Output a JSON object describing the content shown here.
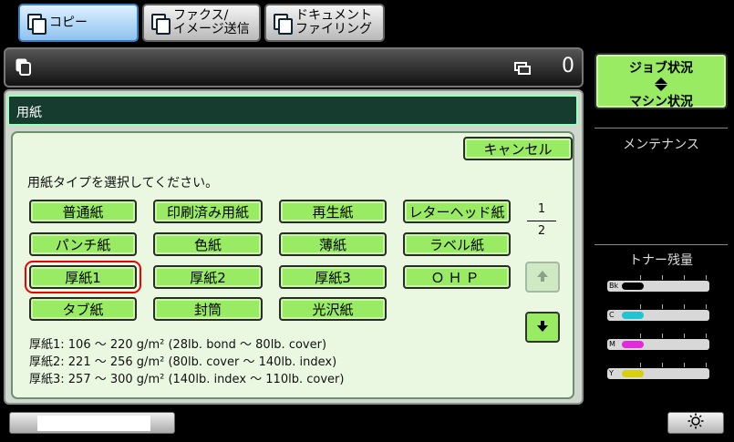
{
  "tabs": [
    {
      "label_1": "コピー",
      "label_2": ""
    },
    {
      "label_1": "ファクス/",
      "label_2": "イメージ送信"
    },
    {
      "label_1": "ドキュメント",
      "label_2": "ファイリング"
    }
  ],
  "status": {
    "job_count": "0"
  },
  "panel": {
    "title": "用紙",
    "cancel_label": "キャンセル",
    "prompt": "用紙タイプを選択してください。",
    "paper_buttons": [
      "普通紙",
      "印刷済み用紙",
      "再生紙",
      "レターヘッド紙",
      "パンチ紙",
      "色紙",
      "薄紙",
      "ラベル紙",
      "厚紙1",
      "厚紙2",
      "厚紙3",
      "ＯＨＰ",
      "タブ紙",
      "封筒",
      "光沢紙"
    ],
    "selected": "厚紙1",
    "page_current": "1",
    "page_total": "2",
    "specs": [
      "厚紙1: 106 ～ 220 g/m² (28lb. bond ～ 80lb. cover)",
      "厚紙2: 221 ～ 256 g/m² (80lb. cover ～ 140lb. index)",
      "厚紙3: 257 ～ 300 g/m² (140lb. index ～ 110lb. cover)"
    ]
  },
  "right": {
    "job_status_label": "ジョブ状況",
    "machine_status_label": "マシン状況",
    "maintenance_label": "メンテナンス",
    "toner_label": "トナー残量",
    "toner": [
      {
        "name": "Bk",
        "level": 0.4,
        "color": "#000000"
      },
      {
        "name": "C",
        "level": 0.4,
        "color": "#23c3d3"
      },
      {
        "name": "M",
        "level": 0.4,
        "color": "#e22ad8"
      },
      {
        "name": "Y",
        "level": 0.4,
        "color": "#d6cf12"
      }
    ]
  },
  "icons": {
    "tab_copy": "copy-icon",
    "tab_fax": "fax-icon",
    "tab_doc": "document-icon",
    "status_copy": "copy-icon",
    "status_job": "copy-stack-icon",
    "brightness": "sun-icon"
  }
}
